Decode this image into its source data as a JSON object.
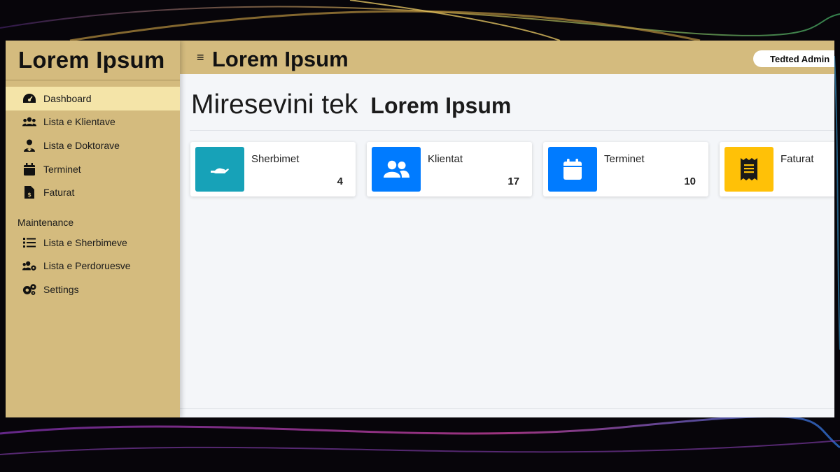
{
  "sidebar": {
    "brand": "Lorem Ipsum",
    "items": [
      {
        "label": "Dashboard",
        "icon": "tachometer-icon",
        "active": true
      },
      {
        "label": "Lista e Klientave",
        "icon": "users-icon"
      },
      {
        "label": "Lista e Doktorave",
        "icon": "user-doctor-icon"
      },
      {
        "label": "Terminet",
        "icon": "calendar-icon"
      },
      {
        "label": "Faturat",
        "icon": "invoice-icon"
      }
    ],
    "section_header": "Maintenance",
    "maintenance_items": [
      {
        "label": "Lista e Sherbimeve",
        "icon": "list-icon"
      },
      {
        "label": "Lista e Perdoruesve",
        "icon": "users-cog-icon"
      },
      {
        "label": "Settings",
        "icon": "cogs-icon"
      }
    ]
  },
  "topbar": {
    "menu_icon": "≡",
    "title": "Lorem Ipsum",
    "user": "Tedted Admin"
  },
  "main": {
    "welcome": "Miresevini tek",
    "welcome_name": "Lorem Ipsum",
    "cards": [
      {
        "label": "Sherbimet",
        "value": "4",
        "color": "#17a2b8",
        "icon": "hand-holding-icon"
      },
      {
        "label": "Klientat",
        "value": "17",
        "color": "#007bff",
        "icon": "users-icon"
      },
      {
        "label": "Terminet",
        "value": "10",
        "color": "#007bff",
        "icon": "calendar-icon"
      },
      {
        "label": "Faturat",
        "value": "",
        "color": "#ffc107",
        "icon": "receipt-icon"
      }
    ]
  },
  "colors": {
    "sidebar_bg": "#d4bb7e",
    "active_item_bg": "#f4e4a8",
    "content_bg": "#f4f6f9"
  }
}
